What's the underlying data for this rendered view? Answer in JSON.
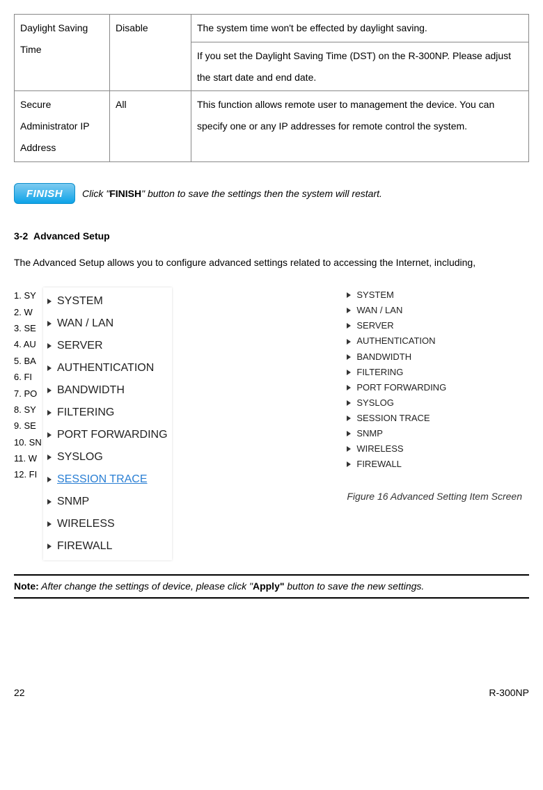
{
  "table": {
    "r1c1": "Daylight Saving Time",
    "r1c2": "Disable",
    "r1c3a": "The system time won't be effected by daylight saving.",
    "r1c3b": "If you set the Daylight Saving Time (DST) on the R-300NP. Please adjust the start date and end date.",
    "r2c1": "Secure Administrator IP Address",
    "r2c2": "All",
    "r2c3": "This function allows remote user to management the device. You can specify one or any IP addresses for remote control the system."
  },
  "finish": {
    "button": "FINISH",
    "pre": " Click \"",
    "bold": "FINISH",
    "post": "\" button to save the settings then the system will restart."
  },
  "section": {
    "num": "3-2",
    "title": "Advanced Setup",
    "intro": "The Advanced Setup allows you to configure advanced settings related to accessing the Internet, including,"
  },
  "listA": [
    "1.   SY",
    "2.   W",
    "3.   SE",
    "4.   AU",
    "5.   BA",
    "6.   FI",
    "7.   PO",
    "8.   SY",
    "9.   SE",
    "10.  SN",
    "11.  W",
    "12.  FI"
  ],
  "menu": [
    "SYSTEM",
    "WAN / LAN",
    "SERVER",
    "AUTHENTICATION",
    "BANDWIDTH",
    "FILTERING",
    "PORT FORWARDING",
    "SYSLOG",
    "SESSION TRACE",
    "SNMP",
    "WIRELESS",
    "FIREWALL"
  ],
  "menuCurrent": "SESSION TRACE",
  "figcap": "Figure 16 Advanced Setting Item Screen",
  "note": {
    "label": "Note:",
    "pre": " After change the settings of device, please click \"",
    "bold": "Apply\"",
    "post": " button to save the new settings."
  },
  "footer": {
    "left": "22",
    "right": "R-300NP"
  }
}
